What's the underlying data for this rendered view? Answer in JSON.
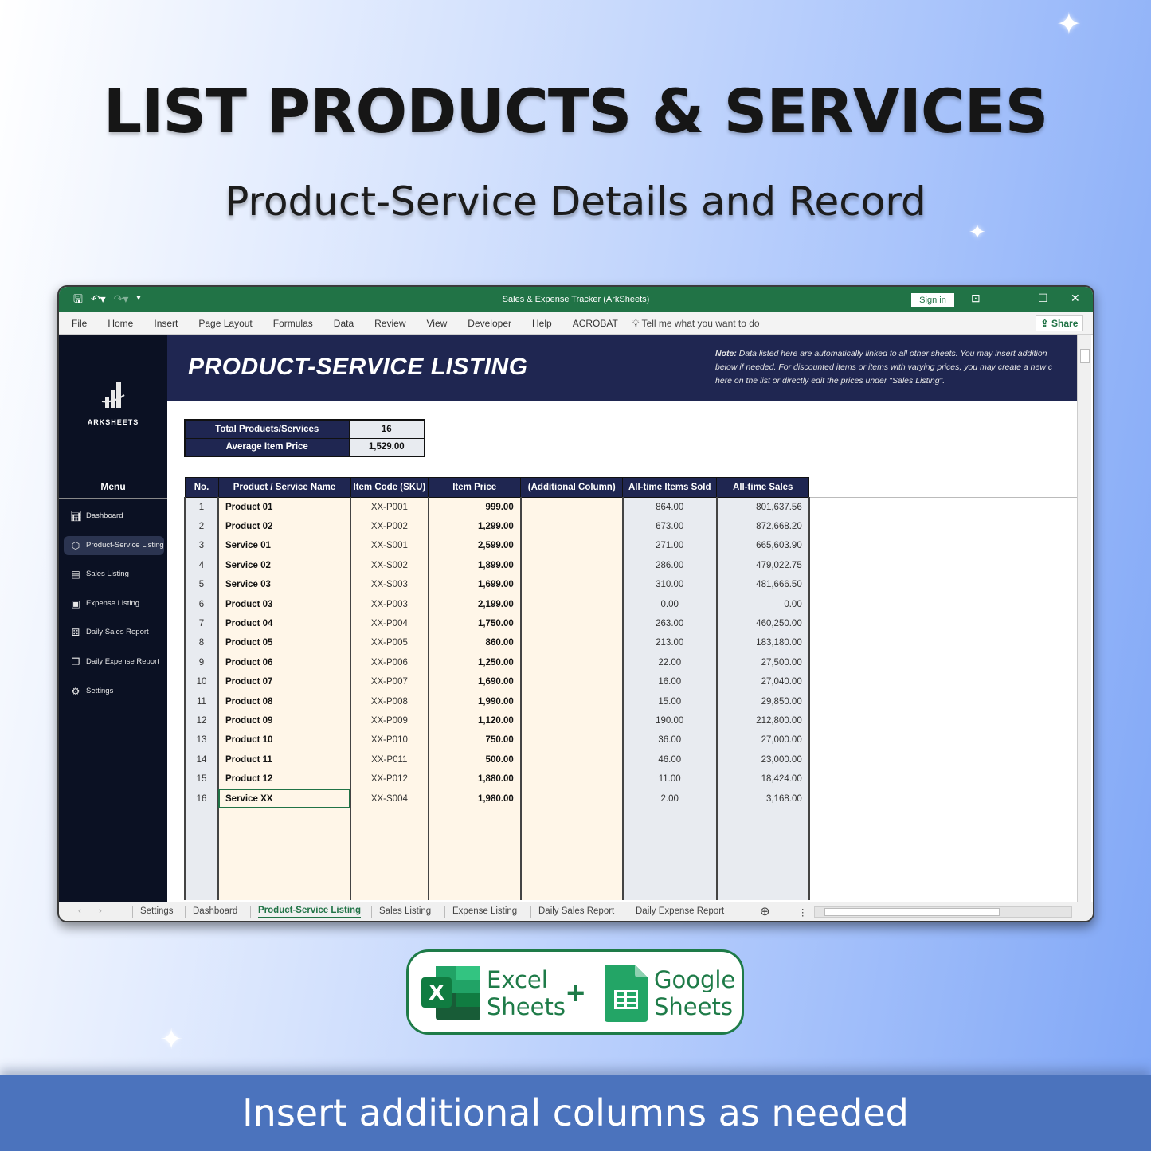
{
  "hero": {
    "title": "LIST PRODUCTS & SERVICES",
    "subtitle": "Product-Service Details and Record"
  },
  "window": {
    "title": "Sales & Expense Tracker (ArkSheets)",
    "sign_in": "Sign in",
    "ribbon_tabs": [
      "File",
      "Home",
      "Insert",
      "Page Layout",
      "Formulas",
      "Data",
      "Review",
      "View",
      "Developer",
      "Help",
      "ACROBAT"
    ],
    "tell_me": "Tell me what you want to do",
    "share": "Share"
  },
  "sidebar": {
    "brand": "ARKSHEETS",
    "menu_heading": "Menu",
    "items": [
      {
        "label": "Dashboard",
        "icon": "bar-chart-icon",
        "active": false
      },
      {
        "label": "Product-Service Listing",
        "icon": "box-icon",
        "active": true
      },
      {
        "label": "Sales Listing",
        "icon": "sales-door-icon",
        "active": false
      },
      {
        "label": "Expense Listing",
        "icon": "expense-door-icon",
        "active": false
      },
      {
        "label": "Daily Sales Report",
        "icon": "report-icon",
        "active": false
      },
      {
        "label": "Daily Expense Report",
        "icon": "documents-icon",
        "active": false
      },
      {
        "label": "Settings",
        "icon": "gear-icon",
        "active": false
      }
    ]
  },
  "banner": {
    "title": "PRODUCT-SERVICE LISTING",
    "note_label": "Note:",
    "note_lines": [
      "Data listed here are automatically linked to all other sheets. You may insert addition",
      "below if needed. For discounted items or items with varying prices, you may create a new c",
      "here on the list or directly edit the prices under \"Sales Listing\"."
    ]
  },
  "stats": {
    "total_label": "Total Products/Services",
    "total_value": "16",
    "avg_label": "Average Item Price",
    "avg_value": "1,529.00"
  },
  "table": {
    "headers": [
      "No.",
      "Product / Service Name",
      "Item Code (SKU)",
      "Item Price",
      "(Additional Column)",
      "All-time Items Sold",
      "All-time Sales"
    ],
    "rows": [
      [
        "1",
        "Product 01",
        "XX-P001",
        "999.00",
        "",
        "864.00",
        "801,637.56"
      ],
      [
        "2",
        "Product 02",
        "XX-P002",
        "1,299.00",
        "",
        "673.00",
        "872,668.20"
      ],
      [
        "3",
        "Service 01",
        "XX-S001",
        "2,599.00",
        "",
        "271.00",
        "665,603.90"
      ],
      [
        "4",
        "Service 02",
        "XX-S002",
        "1,899.00",
        "",
        "286.00",
        "479,022.75"
      ],
      [
        "5",
        "Service 03",
        "XX-S003",
        "1,699.00",
        "",
        "310.00",
        "481,666.50"
      ],
      [
        "6",
        "Product 03",
        "XX-P003",
        "2,199.00",
        "",
        "0.00",
        "0.00"
      ],
      [
        "7",
        "Product 04",
        "XX-P004",
        "1,750.00",
        "",
        "263.00",
        "460,250.00"
      ],
      [
        "8",
        "Product 05",
        "XX-P005",
        "860.00",
        "",
        "213.00",
        "183,180.00"
      ],
      [
        "9",
        "Product 06",
        "XX-P006",
        "1,250.00",
        "",
        "22.00",
        "27,500.00"
      ],
      [
        "10",
        "Product 07",
        "XX-P007",
        "1,690.00",
        "",
        "16.00",
        "27,040.00"
      ],
      [
        "11",
        "Product 08",
        "XX-P008",
        "1,990.00",
        "",
        "15.00",
        "29,850.00"
      ],
      [
        "12",
        "Product 09",
        "XX-P009",
        "1,120.00",
        "",
        "190.00",
        "212,800.00"
      ],
      [
        "13",
        "Product 10",
        "XX-P010",
        "750.00",
        "",
        "36.00",
        "27,000.00"
      ],
      [
        "14",
        "Product 11",
        "XX-P011",
        "500.00",
        "",
        "46.00",
        "23,000.00"
      ],
      [
        "15",
        "Product 12",
        "XX-P012",
        "1,880.00",
        "",
        "11.00",
        "18,424.00"
      ],
      [
        "16",
        "Service XX",
        "XX-S004",
        "1,980.00",
        "",
        "2.00",
        "3,168.00"
      ]
    ],
    "selected_row": 16
  },
  "sheet_tabs": {
    "tabs": [
      "Settings",
      "Dashboard",
      "Product-Service Listing",
      "Sales Listing",
      "Expense Listing",
      "Daily Sales Report",
      "Daily Expense Report"
    ],
    "active": "Product-Service Listing"
  },
  "badge": {
    "excel_line1": "Excel",
    "excel_line2": "Sheets",
    "plus": "+",
    "google_line1": "Google",
    "google_line2": "Sheets"
  },
  "footer": {
    "text": "Insert additional columns as needed"
  },
  "colors": {
    "excel_green": "#217346",
    "navy": "#1f2651",
    "sidebar_bg": "#0b1123",
    "input_cell": "#fff6e8",
    "calc_cell": "#e8ebf0",
    "footer_blue": "#4b73bd"
  }
}
